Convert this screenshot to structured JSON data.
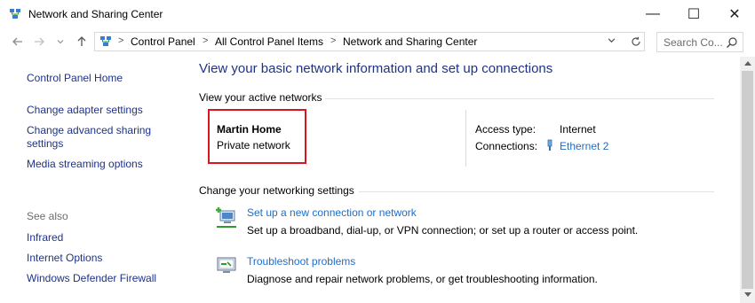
{
  "window": {
    "title": "Network and Sharing Center",
    "controls": {
      "minimize": "—",
      "maximize": "☐",
      "close": "✕"
    }
  },
  "nav": {
    "back_icon": "arrow-left",
    "forward_icon": "arrow-right",
    "recent_icon": "chevron-down",
    "up_icon": "arrow-up",
    "breadcrumb": [
      "Control Panel",
      "All Control Panel Items",
      "Network and Sharing Center"
    ],
    "refresh_icon": "refresh",
    "search_placeholder": "Search Co..."
  },
  "sidebar": {
    "home": "Control Panel Home",
    "links": [
      "Change adapter settings",
      "Change advanced sharing settings",
      "Media streaming options"
    ],
    "see_also_label": "See also",
    "see_also": [
      "Infrared",
      "Internet Options",
      "Windows Defender Firewall"
    ]
  },
  "main": {
    "title": "View your basic network information and set up connections",
    "active_networks_label": "View your active networks",
    "network": {
      "name": "Martin Home",
      "type": "Private network",
      "access_type_label": "Access type:",
      "access_type_value": "Internet",
      "connections_label": "Connections:",
      "connections_value": "Ethernet 2"
    },
    "change_settings_label": "Change your networking settings",
    "tasks": [
      {
        "link": "Set up a new connection or network",
        "desc": "Set up a broadband, dial-up, or VPN connection; or set up a router or access point.",
        "icon": "new-connection-icon"
      },
      {
        "link": "Troubleshoot problems",
        "desc": "Diagnose and repair network problems, or get troubleshooting information.",
        "icon": "troubleshoot-icon"
      }
    ]
  },
  "colors": {
    "link_dark": "#1e3287",
    "link": "#1e6ec8",
    "highlight_box": "#d9161b"
  }
}
